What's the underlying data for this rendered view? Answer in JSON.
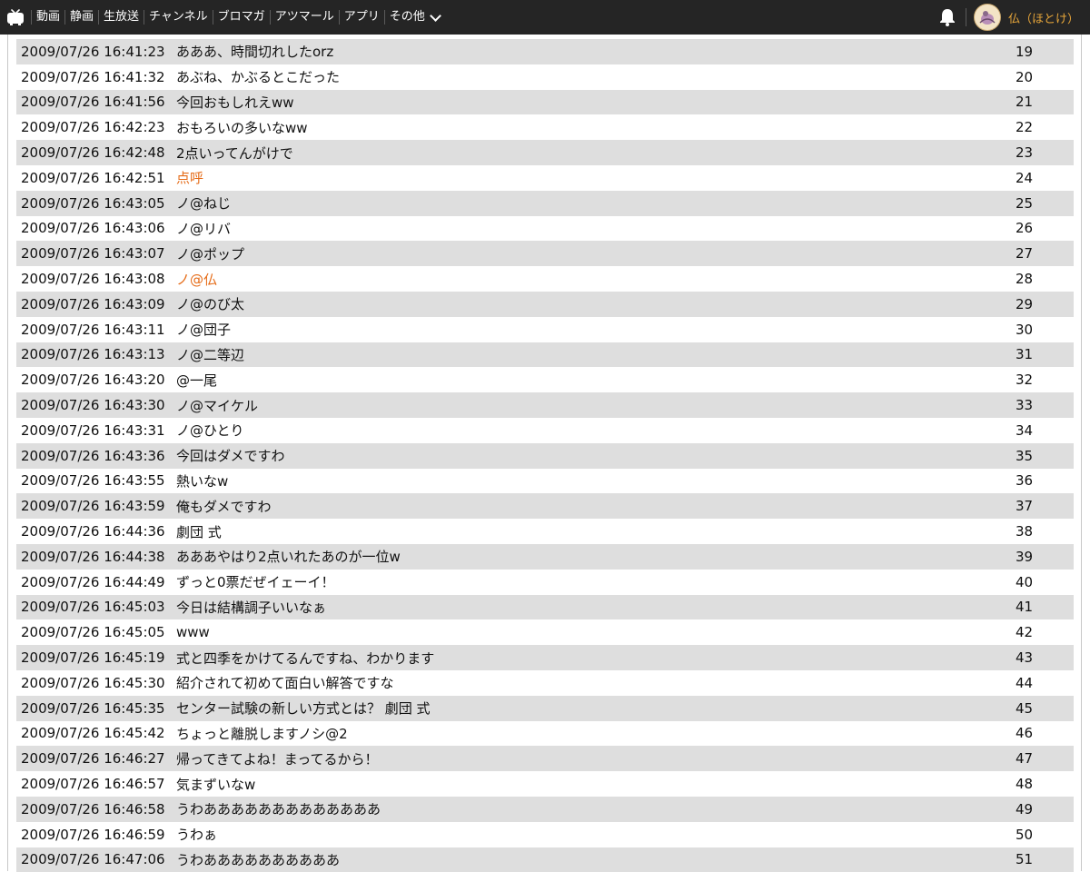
{
  "nav": {
    "items": [
      "動画",
      "静画",
      "生放送",
      "チャンネル",
      "ブロマガ",
      "アツマール",
      "アプリ"
    ],
    "more_label": "その他"
  },
  "user": {
    "name": "仏（ほとけ）"
  },
  "colors": {
    "topbar": "#252525",
    "highlight": "#e56b17",
    "row_shade": "#dedede",
    "username": "#e7a63a"
  },
  "comments": [
    {
      "datetime": "2009/07/26 16:41:23",
      "text": "あああ、時間切れしたorz",
      "no": "19",
      "highlight": false
    },
    {
      "datetime": "2009/07/26 16:41:32",
      "text": "あぶね、かぶるとこだった",
      "no": "20",
      "highlight": false
    },
    {
      "datetime": "2009/07/26 16:41:56",
      "text": "今回おもしれえww",
      "no": "21",
      "highlight": false
    },
    {
      "datetime": "2009/07/26 16:42:23",
      "text": "おもろいの多いなww",
      "no": "22",
      "highlight": false
    },
    {
      "datetime": "2009/07/26 16:42:48",
      "text": "2点いってんがけで",
      "no": "23",
      "highlight": false
    },
    {
      "datetime": "2009/07/26 16:42:51",
      "text": "点呼",
      "no": "24",
      "highlight": true
    },
    {
      "datetime": "2009/07/26 16:43:05",
      "text": "ノ@ねじ",
      "no": "25",
      "highlight": false
    },
    {
      "datetime": "2009/07/26 16:43:06",
      "text": "ノ@リバ",
      "no": "26",
      "highlight": false
    },
    {
      "datetime": "2009/07/26 16:43:07",
      "text": "ノ@ポップ",
      "no": "27",
      "highlight": false
    },
    {
      "datetime": "2009/07/26 16:43:08",
      "text": "ノ@仏",
      "no": "28",
      "highlight": true
    },
    {
      "datetime": "2009/07/26 16:43:09",
      "text": "ノ@のび太",
      "no": "29",
      "highlight": false
    },
    {
      "datetime": "2009/07/26 16:43:11",
      "text": "ノ@団子",
      "no": "30",
      "highlight": false
    },
    {
      "datetime": "2009/07/26 16:43:13",
      "text": "ノ@二等辺",
      "no": "31",
      "highlight": false
    },
    {
      "datetime": "2009/07/26 16:43:20",
      "text": "@一尾",
      "no": "32",
      "highlight": false
    },
    {
      "datetime": "2009/07/26 16:43:30",
      "text": "ノ@マイケル",
      "no": "33",
      "highlight": false
    },
    {
      "datetime": "2009/07/26 16:43:31",
      "text": "ノ@ひとり",
      "no": "34",
      "highlight": false
    },
    {
      "datetime": "2009/07/26 16:43:36",
      "text": "今回はダメですわ",
      "no": "35",
      "highlight": false
    },
    {
      "datetime": "2009/07/26 16:43:55",
      "text": "熱いなw",
      "no": "36",
      "highlight": false
    },
    {
      "datetime": "2009/07/26 16:43:59",
      "text": "俺もダメですわ",
      "no": "37",
      "highlight": false
    },
    {
      "datetime": "2009/07/26 16:44:36",
      "text": "劇団 式",
      "no": "38",
      "highlight": false
    },
    {
      "datetime": "2009/07/26 16:44:38",
      "text": "あああやはり2点いれたあのが一位w",
      "no": "39",
      "highlight": false
    },
    {
      "datetime": "2009/07/26 16:44:49",
      "text": "ずっと0票だぜイェーイ！",
      "no": "40",
      "highlight": false
    },
    {
      "datetime": "2009/07/26 16:45:03",
      "text": "今日は結構調子いいなぁ",
      "no": "41",
      "highlight": false
    },
    {
      "datetime": "2009/07/26 16:45:05",
      "text": "www",
      "no": "42",
      "highlight": false
    },
    {
      "datetime": "2009/07/26 16:45:19",
      "text": "式と四季をかけてるんですね、わかります",
      "no": "43",
      "highlight": false
    },
    {
      "datetime": "2009/07/26 16:45:30",
      "text": "紹介されて初めて面白い解答ですな",
      "no": "44",
      "highlight": false
    },
    {
      "datetime": "2009/07/26 16:45:35",
      "text": "センター試験の新しい方式とは？ 劇団 式",
      "no": "45",
      "highlight": false
    },
    {
      "datetime": "2009/07/26 16:45:42",
      "text": "ちょっと離脱しますノシ@2",
      "no": "46",
      "highlight": false
    },
    {
      "datetime": "2009/07/26 16:46:27",
      "text": "帰ってきてよね！まってるから！",
      "no": "47",
      "highlight": false
    },
    {
      "datetime": "2009/07/26 16:46:57",
      "text": "気まずいなw",
      "no": "48",
      "highlight": false
    },
    {
      "datetime": "2009/07/26 16:46:58",
      "text": "うわあああああああああああああ",
      "no": "49",
      "highlight": false
    },
    {
      "datetime": "2009/07/26 16:46:59",
      "text": "うわぁ",
      "no": "50",
      "highlight": false
    },
    {
      "datetime": "2009/07/26 16:47:06",
      "text": "うわああああああああああ",
      "no": "51",
      "highlight": false
    }
  ]
}
